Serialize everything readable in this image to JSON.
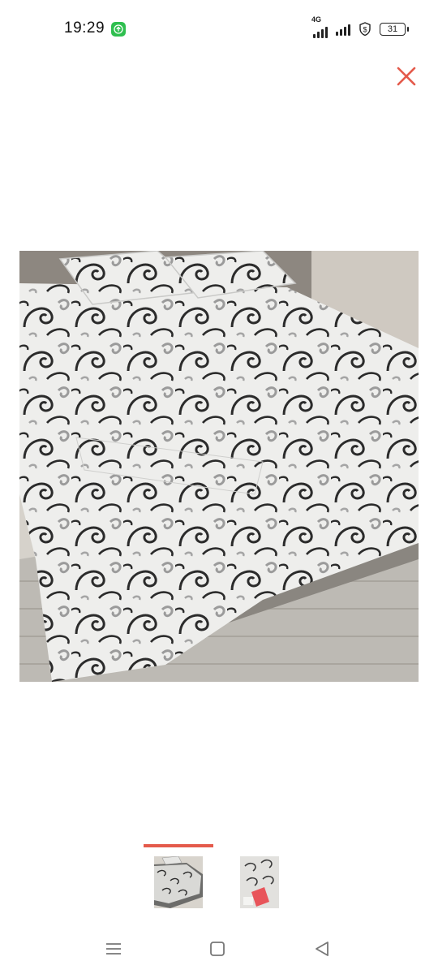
{
  "status_bar": {
    "time": "19:29",
    "network_label": "4G",
    "battery_level": "31",
    "icons": [
      "upload-notification-icon",
      "signal-4g-icon",
      "signal-icon",
      "vpn-shield-icon",
      "battery-icon"
    ]
  },
  "viewer": {
    "close_icon": "close-icon",
    "accent_color": "#e45a4b",
    "main_image_alt": "bedspread-photo",
    "thumbnails": [
      {
        "name": "thumbnail-bed",
        "selected": true
      },
      {
        "name": "thumbnail-package",
        "selected": false
      }
    ]
  },
  "nav_bar": {
    "icons": [
      "menu-icon",
      "home-square-icon",
      "back-triangle-icon"
    ]
  }
}
